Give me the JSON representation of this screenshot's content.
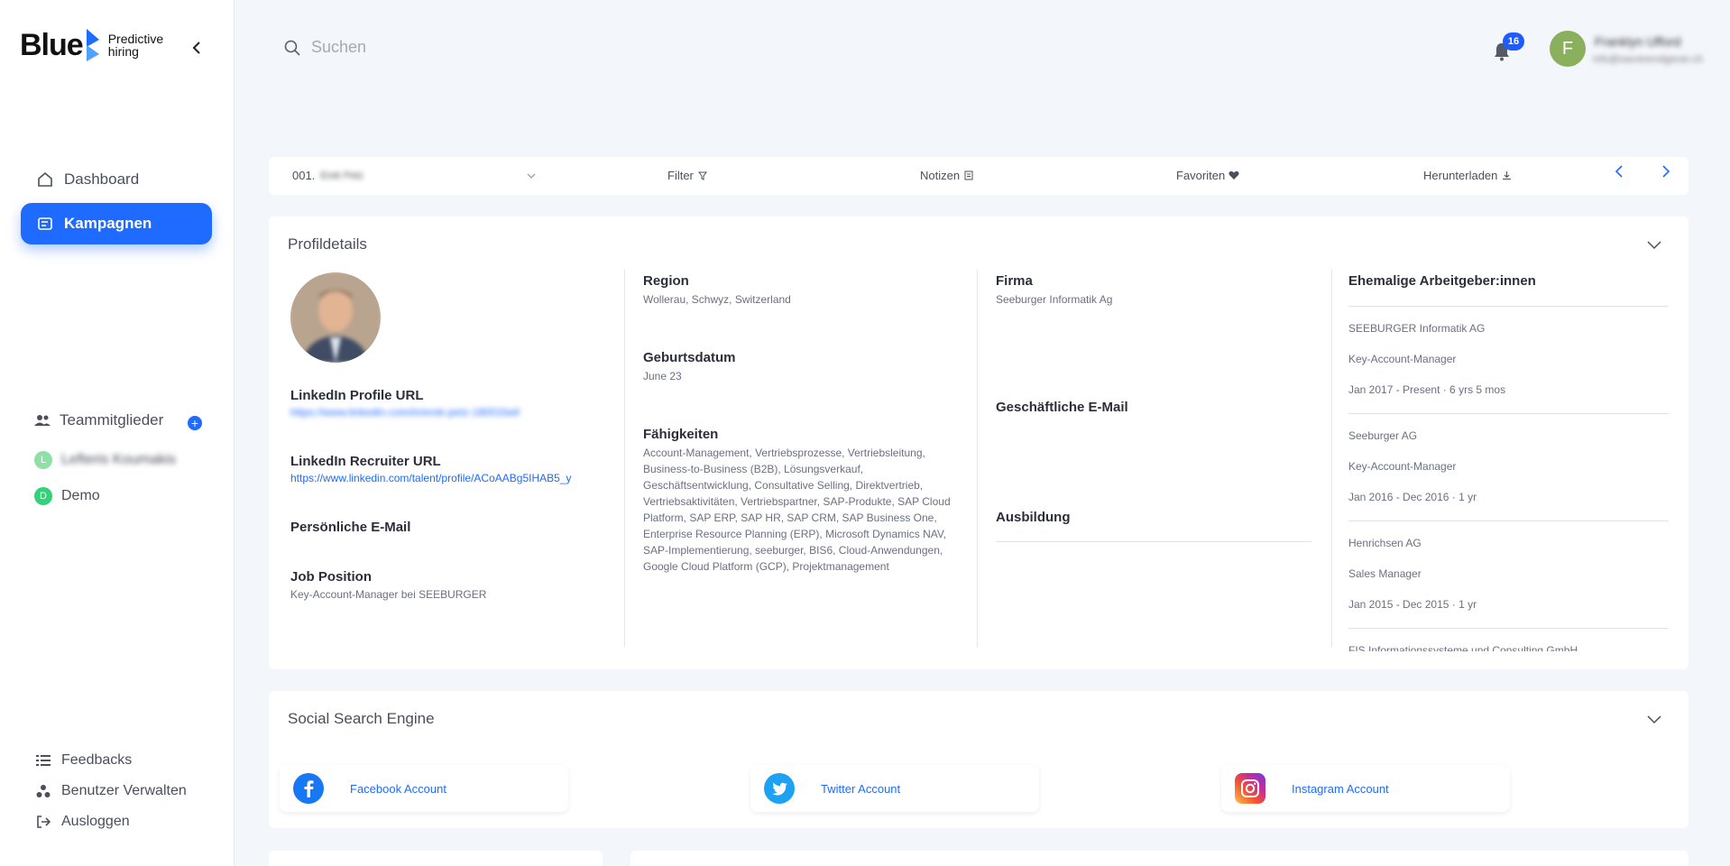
{
  "brand": {
    "word": "Blue",
    "tagline_1": "Predictive",
    "tagline_2": "hiring"
  },
  "sidebar": {
    "items": [
      {
        "label": "Dashboard",
        "icon": "home-icon"
      },
      {
        "label": "Kampagnen",
        "icon": "campaign-icon",
        "active": true
      }
    ],
    "team": {
      "label": "Teammitglieder",
      "members": [
        {
          "initial": "L",
          "name": "Lefteris Koumakis",
          "color": "#8ee0a8"
        },
        {
          "initial": "D",
          "name": "Demo",
          "color": "#33d17a"
        }
      ]
    },
    "bottom": [
      {
        "label": "Feedbacks",
        "icon": "list-icon"
      },
      {
        "label": "Benutzer Verwalten",
        "icon": "users-icon"
      },
      {
        "label": "Ausloggen",
        "icon": "logout-icon"
      }
    ]
  },
  "header": {
    "search_placeholder": "Suchen",
    "notification_count": "16",
    "user": {
      "initial": "F",
      "name": "Franklyn Ufford",
      "email": "info@ssextremdgener.ch"
    }
  },
  "toolbar": {
    "candidate": "001.",
    "candidate_name": "Erek Petz",
    "filter": "Filter",
    "notes": "Notizen",
    "favorites": "Favoriten",
    "download": "Herunterladen"
  },
  "profile": {
    "title": "Profildetails",
    "linkedin_profile_label": "LinkedIn Profile URL",
    "linkedin_profile_url": "https://www.linkedin.com/in/erek-petz-18001fa4/",
    "linkedin_recruiter_label": "LinkedIn Recruiter URL",
    "linkedin_recruiter_url": "https://www.linkedin.com/talent/profile/ACoAABg5IHAB5_y",
    "personal_email_label": "Persönliche E-Mail",
    "job_position_label": "Job Position",
    "job_position": "Key-Account-Manager bei SEEBURGER",
    "region_label": "Region",
    "region": "Wollerau, Schwyz, Switzerland",
    "birthdate_label": "Geburtsdatum",
    "birthdate": "June 23",
    "skills_label": "Fähigkeiten",
    "skills": "Account-Management, Vertriebsprozesse, Vertriebsleitung, Business-to-Business (B2B), Lösungsverkauf, Geschäftsentwicklung, Consultative Selling, Direktvertrieb, Vertriebsaktivitäten, Vertriebspartner, SAP-Produkte, SAP Cloud Platform, SAP ERP, SAP HR, SAP CRM, SAP Business One, Enterprise Resource Planning (ERP), Microsoft Dynamics NAV, SAP-Implementierung, seeburger, BIS6, Cloud-Anwendungen, Google Cloud Platform (GCP), Projektmanagement",
    "company_label": "Firma",
    "company": "Seeburger Informatik Ag",
    "business_email_label": "Geschäftliche E-Mail",
    "education_label": "Ausbildung",
    "former_employers_label": "Ehemalige Arbeitgeber:innen",
    "former_employers": [
      {
        "company": "SEEBURGER Informatik AG",
        "role": "Key-Account-Manager",
        "period": "Jan 2017 - Present · 6 yrs 5 mos"
      },
      {
        "company": "Seeburger AG",
        "role": "Key-Account-Manager",
        "period": "Jan 2016 - Dec 2016 · 1 yr"
      },
      {
        "company": "Henrichsen AG",
        "role": "Sales Manager",
        "period": "Jan 2015 - Dec 2015 · 1 yr"
      },
      {
        "company": "FIS Informationssysteme und Consulting GmbH"
      }
    ]
  },
  "social": {
    "title": "Social Search Engine",
    "facebook": "Facebook Account",
    "twitter": "Twitter Account",
    "instagram": "Instagram Account"
  }
}
